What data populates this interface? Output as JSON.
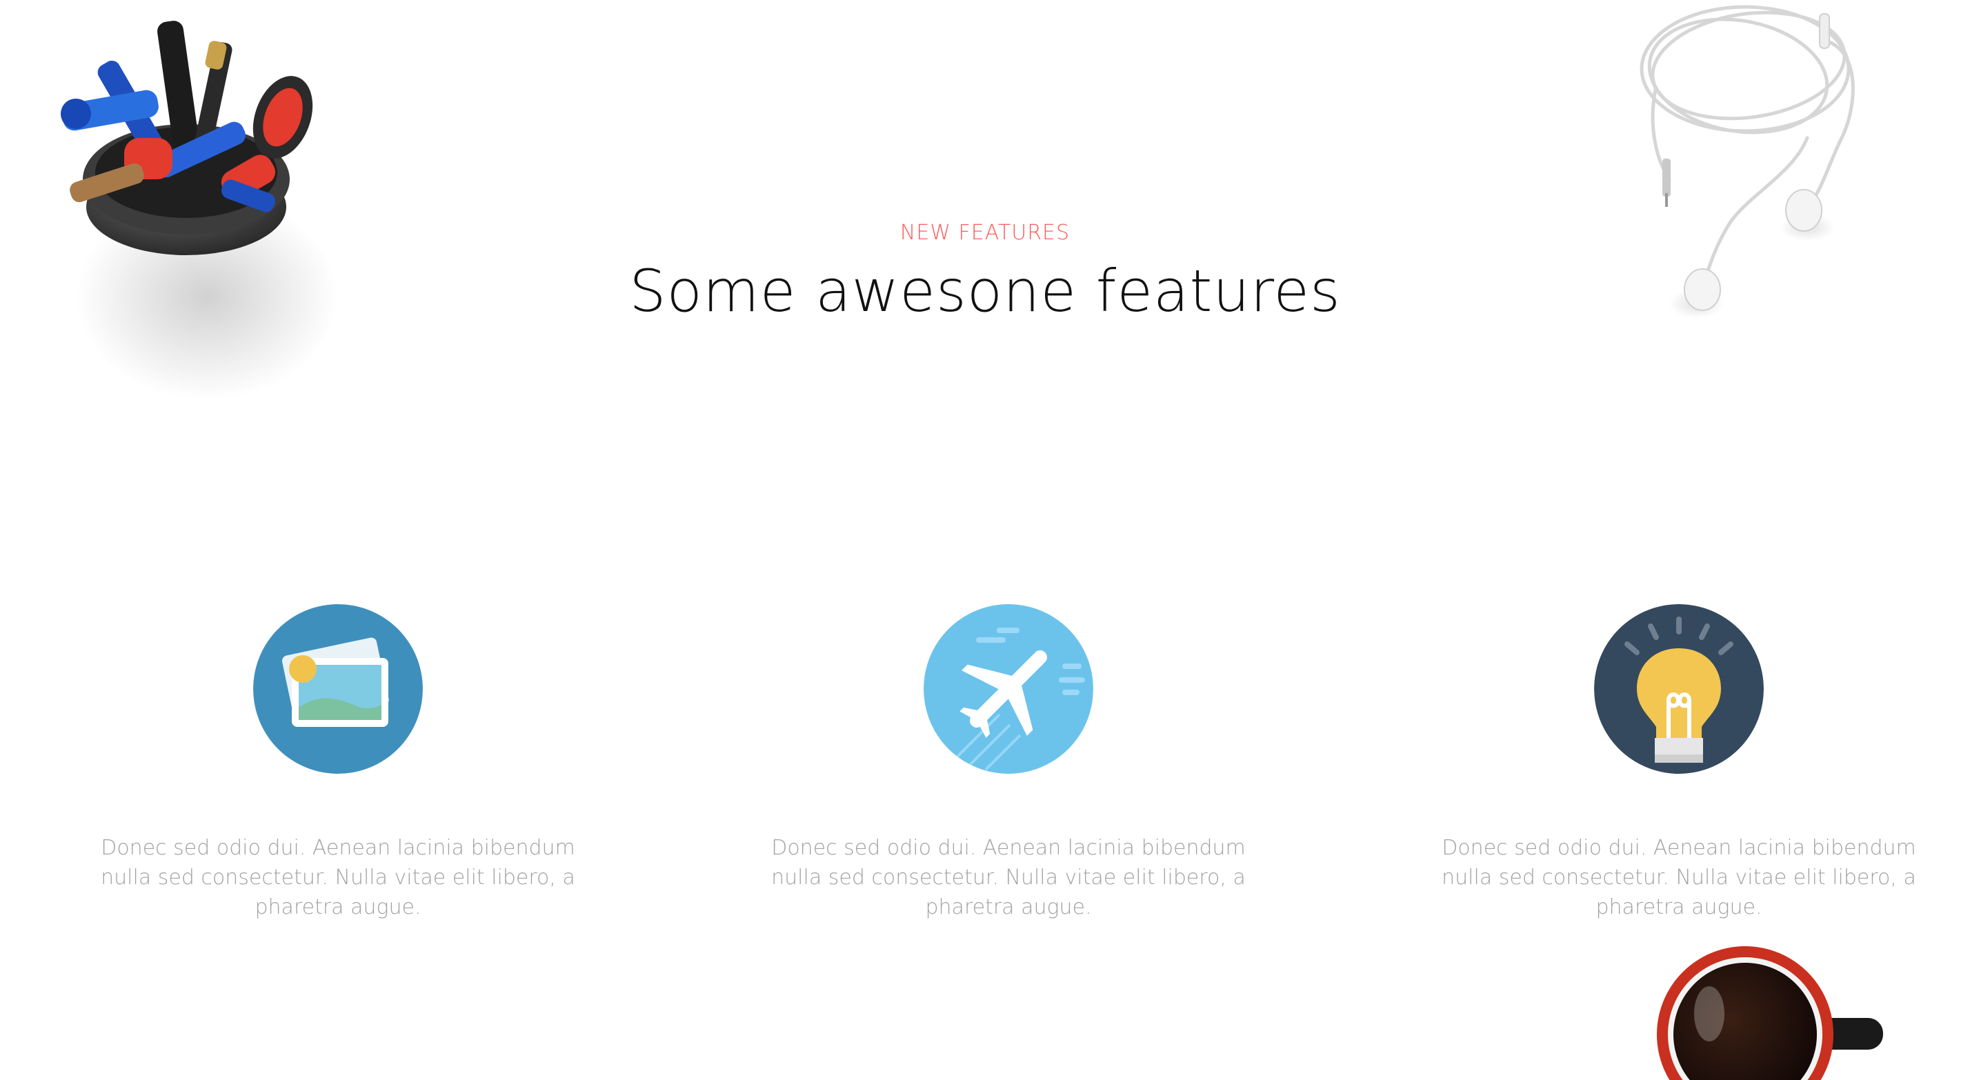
{
  "header": {
    "eyebrow": "NEW FEATURES",
    "title": "Some awesone features"
  },
  "features": [
    {
      "icon": "photo-gallery-icon",
      "icon_bg": "#3f8fbd",
      "text": "Donec sed odio dui. Aenean lacinia bibendum nulla sed consectetur. Nulla vitae elit libero, a pharetra augue."
    },
    {
      "icon": "airplane-icon",
      "icon_bg": "#6bc3ec",
      "text": "Donec sed odio dui. Aenean lacinia bibendum nulla sed consectetur. Nulla vitae elit libero, a pharetra augue."
    },
    {
      "icon": "lightbulb-icon",
      "icon_bg": "#34495e",
      "text": "Donec sed odio dui. Aenean lacinia bibendum nulla sed consectetur. Nulla vitae elit libero, a pharetra augue."
    }
  ],
  "decorations": [
    "pen-holder-photo",
    "earphones-photo",
    "coffee-cup-photo"
  ],
  "colors": {
    "accent": "#ff5a5a",
    "title": "#111111",
    "body_text": "#a2a2a2",
    "background": "#ffffff"
  }
}
